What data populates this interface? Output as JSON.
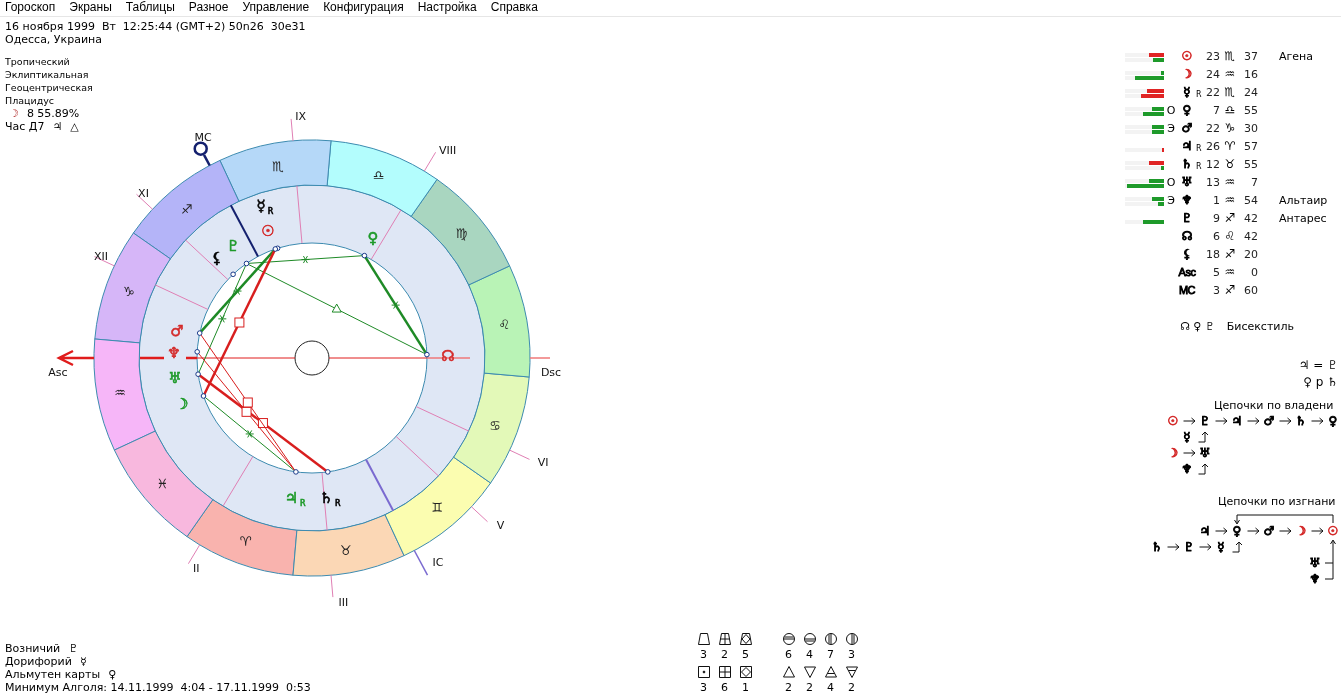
{
  "menu": [
    "Гороскоп",
    "Экраны",
    "Таблицы",
    "Разное",
    "Управление",
    "Конфигурация",
    "Настройка",
    "Справка"
  ],
  "header": {
    "datetime": "16 ноября 1999  Вт  12:25:44 (GMT+2) 50n26  30e31",
    "place": "Одесса, Украина",
    "settings": [
      "Тропический",
      "Эклиптикальная",
      "Геоцентрическая",
      "Плацидус"
    ],
    "moon_phase": {
      "glyph": "☽",
      "value": "8 55.89%"
    },
    "planetary_hour": {
      "label": "Час Д7",
      "ruler": "♃",
      "aspect": "△"
    }
  },
  "wheel": {
    "signs": [
      {
        "glyph": "♈",
        "color": "#f9b3ae"
      },
      {
        "glyph": "♉",
        "color": "#fbd7b5"
      },
      {
        "glyph": "♊",
        "color": "#fbfdb0"
      },
      {
        "glyph": "♋",
        "color": "#e3f9b8"
      },
      {
        "glyph": "♌",
        "color": "#b9f3b6"
      },
      {
        "glyph": "♍",
        "color": "#a9d6c0"
      },
      {
        "glyph": "♎",
        "color": "#b3fdfd"
      },
      {
        "glyph": "♏",
        "color": "#b5d8f8"
      },
      {
        "glyph": "♐",
        "color": "#b4b4f8"
      },
      {
        "glyph": "♑",
        "color": "#d6b6f8"
      },
      {
        "glyph": "♒",
        "color": "#f6b6f8"
      },
      {
        "glyph": "♓",
        "color": "#f8b8de"
      }
    ],
    "house_labels": [
      "II",
      "III",
      "V",
      "VI",
      "VIII",
      "IX",
      "XI",
      "XII"
    ],
    "angles": {
      "asc": "Asc",
      "ic": "IC",
      "dsc": "Dsc",
      "mc": "MC"
    },
    "planets": [
      {
        "glyph": "☿",
        "retro": "R",
        "color": "#000000"
      },
      {
        "glyph": "☉",
        "color": "#d42a2a"
      },
      {
        "glyph": "♀",
        "color": "#1e9a2a"
      },
      {
        "glyph": "♇",
        "color": "#1e9a2a"
      },
      {
        "glyph": "⚸",
        "color": "#000000"
      },
      {
        "glyph": "♂",
        "color": "#d42a2a"
      },
      {
        "glyph": "♆",
        "color": "#d42a2a"
      },
      {
        "glyph": "☊",
        "color": "#d42a2a"
      },
      {
        "glyph": "♅",
        "color": "#1e9a2a"
      },
      {
        "glyph": "☽",
        "color": "#1e9a2a"
      },
      {
        "glyph": "♃",
        "retro": "R",
        "color": "#1e9a2a"
      },
      {
        "glyph": "♄",
        "retro": "R",
        "color": "#000000"
      }
    ]
  },
  "positions": [
    {
      "bars": [
        {
          "color": "#e02424",
          "level": 0.38
        },
        {
          "color": "#1e9a2a",
          "level": 0.28
        }
      ],
      "glyph": "☉",
      "color": "#d42a2a",
      "degree": "23",
      "sign": "♏",
      "minute": "37",
      "star": "Агена"
    },
    {
      "bars": [
        {
          "color": "#1e9a2a",
          "level": 0.08
        },
        {
          "color": "#1e9a2a",
          "level": 0.74
        }
      ],
      "glyph": "☽",
      "color": "#d42a2a",
      "degree": "24",
      "sign": "♒",
      "minute": "16"
    },
    {
      "bars": [
        {
          "color": "#e02424",
          "level": 0.43
        },
        {
          "color": "#e02424",
          "level": 0.6
        }
      ],
      "glyph": "☿",
      "retro": "R",
      "color": "#000000",
      "degree": "22",
      "sign": "♏",
      "minute": "24"
    },
    {
      "bars": [
        {
          "color": "#1e9a2a",
          "level": 0.3
        },
        {
          "color": "#1e9a2a",
          "level": 0.55
        }
      ],
      "dignity": "О",
      "glyph": "♀",
      "color": "#000000",
      "degree": "7",
      "sign": "♎",
      "minute": "55"
    },
    {
      "bars": [
        {
          "color": "#1e9a2a",
          "level": 0.32
        },
        {
          "color": "#1e9a2a",
          "level": 0.32
        }
      ],
      "dignity": "Э",
      "glyph": "♂",
      "color": "#000000",
      "degree": "22",
      "sign": "♑",
      "minute": "30"
    },
    {
      "bars": [
        {
          "color": "#e02424",
          "level": 0.06
        }
      ],
      "glyph": "♃",
      "retro": "R",
      "color": "#000000",
      "degree": "26",
      "sign": "♈",
      "minute": "57"
    },
    {
      "bars": [
        {
          "color": "#e02424",
          "level": 0.38
        },
        {
          "color": "#1e9a2a",
          "level": 0.08
        }
      ],
      "glyph": "♄",
      "retro": "R",
      "color": "#000000",
      "degree": "12",
      "sign": "♉",
      "minute": "55"
    },
    {
      "bars": [
        {
          "color": "#1e9a2a",
          "level": 0.38
        },
        {
          "color": "#1e9a2a",
          "level": 0.95
        }
      ],
      "dignity": "О",
      "glyph": "♅",
      "color": "#000000",
      "degree": "13",
      "sign": "♒",
      "minute": "7"
    },
    {
      "bars": [
        {
          "color": "#1e9a2a",
          "level": 0.3
        },
        {
          "color": "#1e9a2a",
          "level": 0.15
        }
      ],
      "dignity": "Э",
      "glyph": "♆",
      "color": "#000000",
      "degree": "1",
      "sign": "♒",
      "minute": "54",
      "star": "Альтаир"
    },
    {
      "bars": [
        {
          "color": "#1e9a2a",
          "level": 0.55
        }
      ],
      "glyph": "♇",
      "color": "#000000",
      "degree": "9",
      "sign": "♐",
      "minute": "42",
      "star": "Антарес"
    },
    {
      "glyph": "☊",
      "color": "#000000",
      "degree": "6",
      "sign": "♌",
      "minute": "42"
    },
    {
      "glyph": "⚸",
      "color": "#000000",
      "degree": "18",
      "sign": "♐",
      "minute": "20"
    },
    {
      "glyph": "Asc",
      "color": "#000000",
      "degree": "5",
      "sign": "♒",
      "minute": "0"
    },
    {
      "glyph": "MC",
      "color": "#000000",
      "degree": "3",
      "sign": "♐",
      "minute": "60"
    }
  ],
  "aspect_pattern": {
    "glyphs": "☊ ♀ ♇",
    "name": "Бисекстиль"
  },
  "formulas": [
    "♃ = ♇",
    "♀ p ♄"
  ],
  "ownership_chains": {
    "title": "Цепочки по владени",
    "rows": [
      {
        "kind": "chain",
        "items": [
          {
            "glyph": "☉",
            "color": "#d42a2a"
          },
          {
            "glyph": "♇",
            "color": "#000000"
          },
          {
            "glyph": "♃",
            "color": "#000000"
          },
          {
            "glyph": "♂",
            "color": "#000000"
          },
          {
            "glyph": "♄",
            "color": "#000000"
          },
          {
            "glyph": "♀",
            "color": "#000000"
          }
        ]
      },
      {
        "kind": "feeder",
        "items": [
          {
            "glyph": "☿",
            "color": "#000000"
          }
        ]
      },
      {
        "kind": "chain",
        "items": [
          {
            "glyph": "☽",
            "color": "#d42a2a"
          },
          {
            "glyph": "♅",
            "color": "#000000"
          }
        ]
      },
      {
        "kind": "feeder",
        "items": [
          {
            "glyph": "♆",
            "color": "#000000"
          }
        ]
      }
    ]
  },
  "exile_chains": {
    "title": "Цепочки по изгнани",
    "rows": [
      {
        "kind": "loop",
        "items": [
          {
            "glyph": "♃",
            "color": "#000000"
          },
          {
            "glyph": "♀",
            "color": "#000000"
          },
          {
            "glyph": "♂",
            "color": "#000000"
          },
          {
            "glyph": "☽",
            "color": "#d42a2a"
          },
          {
            "glyph": "☉",
            "color": "#d42a2a"
          }
        ]
      },
      {
        "kind": "feeder",
        "items": [
          {
            "glyph": "♄",
            "color": "#000000"
          },
          {
            "glyph": "♇",
            "color": "#000000"
          },
          {
            "glyph": "☿",
            "color": "#000000"
          }
        ]
      },
      {
        "kind": "side",
        "items": [
          {
            "glyph": "♅",
            "color": "#000000"
          }
        ]
      },
      {
        "kind": "side",
        "items": [
          {
            "glyph": "♆",
            "color": "#000000"
          }
        ]
      }
    ]
  },
  "element_counts": [
    {
      "rows": [
        [
          {
            "kind": "trap",
            "count": "3"
          },
          {
            "kind": "trapcross",
            "count": "2"
          },
          {
            "kind": "trapdiamond",
            "count": "5"
          }
        ],
        [
          {
            "kind": "squaredot",
            "count": "3"
          },
          {
            "kind": "squarecross",
            "count": "6"
          },
          {
            "kind": "squarediamond",
            "count": "1"
          }
        ]
      ]
    },
    {
      "rows": [
        [
          {
            "kind": "moontop",
            "count": "6"
          },
          {
            "kind": "moonbottom",
            "count": "4"
          },
          {
            "kind": "moonleft",
            "count": "7"
          },
          {
            "kind": "moonright",
            "count": "3"
          }
        ],
        [
          {
            "kind": "fire",
            "count": "2"
          },
          {
            "kind": "water",
            "count": "2"
          },
          {
            "kind": "air",
            "count": "4"
          },
          {
            "kind": "earth",
            "count": "2"
          }
        ]
      ]
    }
  ],
  "rulers": [
    {
      "label": "Возничий",
      "glyph": "♇"
    },
    {
      "label": "Дорифорий",
      "glyph": "☿"
    },
    {
      "label": "Альмутен карты",
      "glyph": "♀"
    }
  ],
  "algol": "Минимум Алголя: 14.11.1999  4:04 - 17.11.1999  0:53"
}
